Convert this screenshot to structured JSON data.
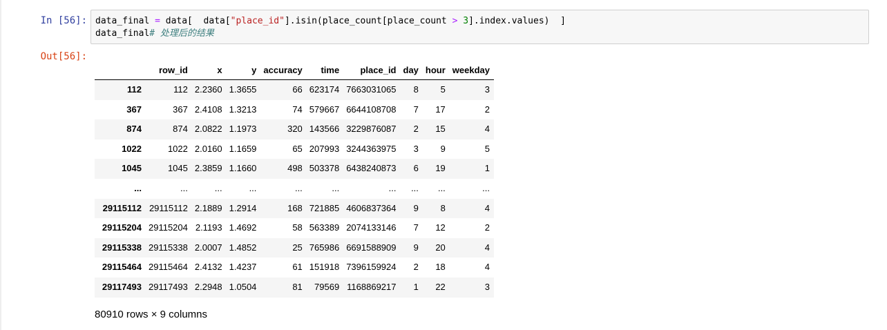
{
  "cell": {
    "in_prompt": "In  [56]:",
    "out_prompt": "Out[56]:",
    "code": {
      "line1": [
        {
          "t": "data_final ",
          "c": ""
        },
        {
          "t": "=",
          "c": "op"
        },
        {
          "t": " data[  data[",
          "c": ""
        },
        {
          "t": "\"place_id\"",
          "c": "str"
        },
        {
          "t": "].isin(place_count[place_count ",
          "c": ""
        },
        {
          "t": ">",
          "c": "op"
        },
        {
          "t": " ",
          "c": ""
        },
        {
          "t": "3",
          "c": "num"
        },
        {
          "t": "].index.values)  ]",
          "c": ""
        }
      ],
      "line2": [
        {
          "t": "data_final",
          "c": ""
        },
        {
          "t": "# 处理后的结果",
          "c": "comment"
        }
      ]
    }
  },
  "dataframe": {
    "columns": [
      "row_id",
      "x",
      "y",
      "accuracy",
      "time",
      "place_id",
      "day",
      "hour",
      "weekday"
    ],
    "rows": [
      {
        "index": "112",
        "cells": [
          "112",
          "2.2360",
          "1.3655",
          "66",
          "623174",
          "7663031065",
          "8",
          "5",
          "3"
        ]
      },
      {
        "index": "367",
        "cells": [
          "367",
          "2.4108",
          "1.3213",
          "74",
          "579667",
          "6644108708",
          "7",
          "17",
          "2"
        ]
      },
      {
        "index": "874",
        "cells": [
          "874",
          "2.0822",
          "1.1973",
          "320",
          "143566",
          "3229876087",
          "2",
          "15",
          "4"
        ]
      },
      {
        "index": "1022",
        "cells": [
          "1022",
          "2.0160",
          "1.1659",
          "65",
          "207993",
          "3244363975",
          "3",
          "9",
          "5"
        ]
      },
      {
        "index": "1045",
        "cells": [
          "1045",
          "2.3859",
          "1.1660",
          "498",
          "503378",
          "6438240873",
          "6",
          "19",
          "1"
        ]
      },
      {
        "index": "...",
        "cells": [
          "...",
          "...",
          "...",
          "...",
          "...",
          "...",
          "...",
          "...",
          "..."
        ]
      },
      {
        "index": "29115112",
        "cells": [
          "29115112",
          "2.1889",
          "1.2914",
          "168",
          "721885",
          "4606837364",
          "9",
          "8",
          "4"
        ]
      },
      {
        "index": "29115204",
        "cells": [
          "29115204",
          "2.1193",
          "1.4692",
          "58",
          "563389",
          "2074133146",
          "7",
          "12",
          "2"
        ]
      },
      {
        "index": "29115338",
        "cells": [
          "29115338",
          "2.0007",
          "1.4852",
          "25",
          "765986",
          "6691588909",
          "9",
          "20",
          "4"
        ]
      },
      {
        "index": "29115464",
        "cells": [
          "29115464",
          "2.4132",
          "1.4237",
          "61",
          "151918",
          "7396159924",
          "2",
          "18",
          "4"
        ]
      },
      {
        "index": "29117493",
        "cells": [
          "29117493",
          "2.2948",
          "1.0504",
          "81",
          "79569",
          "1168869217",
          "1",
          "22",
          "3"
        ]
      }
    ],
    "summary": "80910 rows × 9 columns"
  }
}
